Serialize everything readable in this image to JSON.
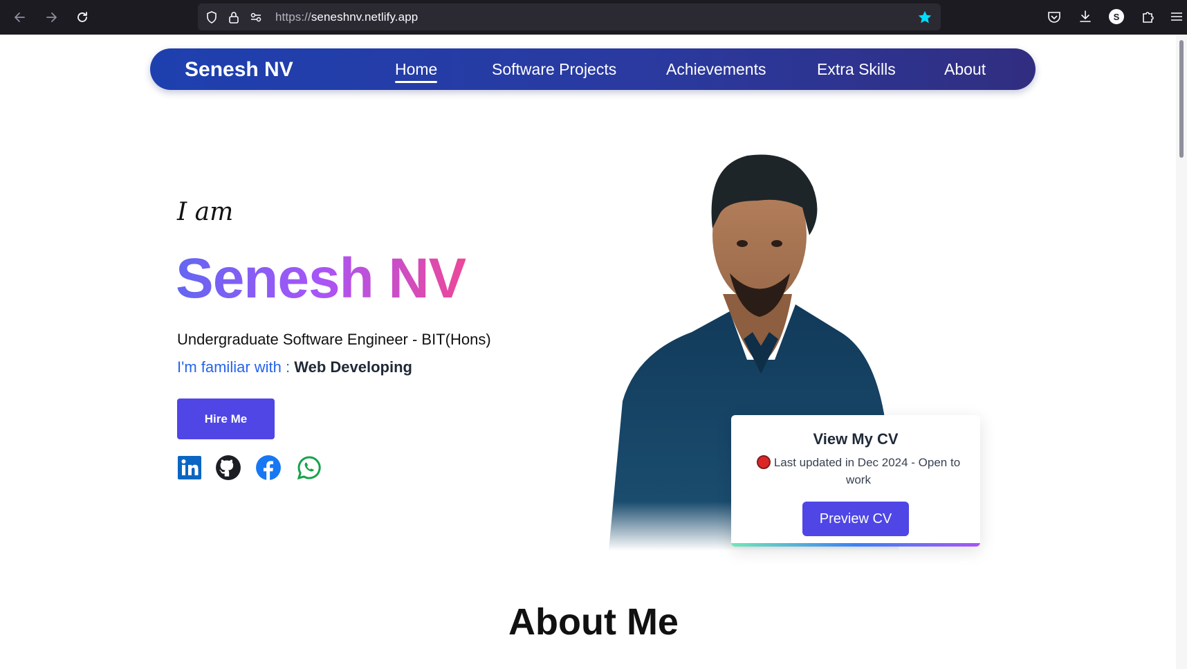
{
  "browser": {
    "url_scheme": "https://",
    "url_host": "seneshnv.netlify.app",
    "profile_initial": "S"
  },
  "navbar": {
    "brand": "Senesh NV",
    "links": [
      {
        "label": "Home",
        "active": true
      },
      {
        "label": "Software Projects",
        "active": false
      },
      {
        "label": "Achievements",
        "active": false
      },
      {
        "label": "Extra Skills",
        "active": false
      },
      {
        "label": "About",
        "active": false
      }
    ]
  },
  "hero": {
    "intro": "I am",
    "name": "Senesh NV",
    "subtitle": "Undergraduate Software Engineer - BIT(Hons)",
    "familiar_prefix": "I'm familiar with : ",
    "familiar_skill": "Web Developing",
    "hire_button": "Hire Me",
    "socials": [
      "linkedin-icon",
      "github-icon",
      "facebook-icon",
      "whatsapp-icon"
    ]
  },
  "cv_card": {
    "title": "View My CV",
    "status": "Last updated in Dec 2024 - Open to work",
    "button": "Preview CV"
  },
  "sections": {
    "about_heading": "About Me"
  },
  "colors": {
    "nav_gradient_start": "#1e40af",
    "nav_gradient_end": "#312e81",
    "accent": "#4f46e5",
    "name_gradient": [
      "#6366f1",
      "#a855f7",
      "#ec4899"
    ],
    "familiar_text": "#2563eb",
    "status_dot": "#dc2626"
  }
}
